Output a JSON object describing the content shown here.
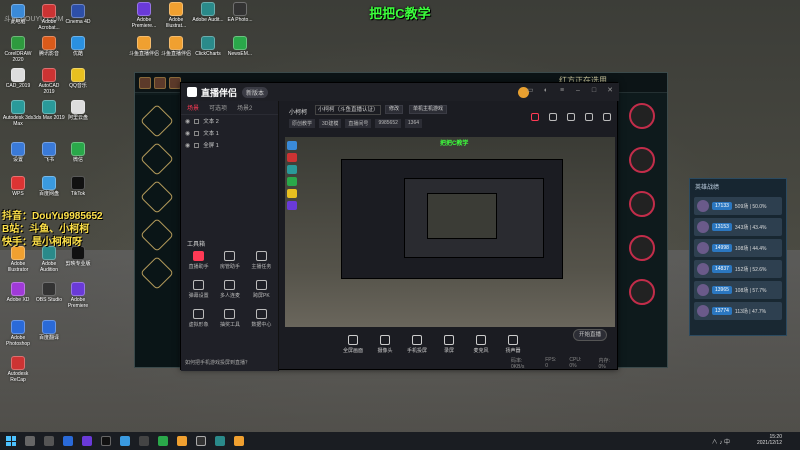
{
  "overlay": {
    "title": "把把C教学",
    "site_logo": "斗鱼 DOUYU.COM",
    "streamer_lines": [
      "抖音：DouYu9985652",
      "B站：斗鱼、小柯柯",
      "快手：是小柯柯呀"
    ]
  },
  "desktop_icons": [
    {
      "label": "此电脑",
      "color": "#3a8ad8"
    },
    {
      "label": "Adobe Acrobat...",
      "color": "#c33"
    },
    {
      "label": "Cinema 4D",
      "color": "#2d4fa8"
    },
    {
      "label": "CorelDRAW 2020",
      "color": "#2e9a3e"
    },
    {
      "label": "腾讯影音",
      "color": "#d95a1a"
    },
    {
      "label": "CAD_2019",
      "color": "#ddd"
    },
    {
      "label": "AutoCAD 2019",
      "color": "#c33"
    },
    {
      "label": "优酷",
      "color": "#2a90e0"
    },
    {
      "label": "Autodesk 3ds Max",
      "color": "#2a9a9a"
    },
    {
      "label": "3ds Max 2019",
      "color": "#2a9a9a"
    },
    {
      "label": "QQ音乐",
      "color": "#e8c020"
    },
    {
      "label": "设置",
      "color": "#3a7ad8"
    },
    {
      "label": "飞书",
      "color": "#3a7ad8"
    },
    {
      "label": "阿里云盘",
      "color": "#ddd"
    },
    {
      "label": "WPS",
      "color": "#d33"
    },
    {
      "label": "百度网盘",
      "color": "#3a9ae0"
    },
    {
      "label": "微信",
      "color": "#2aa84a"
    },
    {
      "label": "Adobe Illustrator",
      "color": "#f0a030"
    },
    {
      "label": "Adobe Audition",
      "color": "#2a8a8a"
    },
    {
      "label": "TikTok",
      "color": "#111"
    },
    {
      "label": "Adobe XD",
      "color": "#a03ad8"
    },
    {
      "label": "剪映专业版",
      "color": "#111"
    },
    {
      "label": "Adobe Photoshop",
      "color": "#2a6ad8"
    },
    {
      "label": "OBS Studio",
      "color": "#333"
    },
    {
      "label": "Adobe Premiere",
      "color": "#6a3ad8"
    },
    {
      "label": "Autodesk ReCap",
      "color": "#c33"
    },
    {
      "label": "百度翻译",
      "color": "#2a6ad8"
    }
  ],
  "top_icons": [
    {
      "label": "Adobe Premiere...",
      "color": "#6a3ad8"
    },
    {
      "label": "Adobe Illustrat...",
      "color": "#f0a030"
    },
    {
      "label": "Adobe Audit...",
      "color": "#2a8a8a"
    },
    {
      "label": "EA Photo...",
      "color": "#333"
    },
    {
      "label": "斗鱼直播伴侣",
      "color": "#f0a030"
    },
    {
      "label": "斗鱼直播伴侣",
      "color": "#f0a030"
    },
    {
      "label": "ClickCharts",
      "color": "#2a8a8a"
    },
    {
      "label": "NewsEM...",
      "color": "#2aa84a"
    }
  ],
  "game_window": {
    "header_text": "红方正在选用",
    "right_rings": 5
  },
  "record_panel": {
    "title": "英雄战绩",
    "rows": [
      {
        "level": "17133",
        "stat": "509场 | 50.0%"
      },
      {
        "level": "13153",
        "stat": "343场 | 43.4%"
      },
      {
        "level": "14998",
        "stat": "108场 | 44.4%"
      },
      {
        "level": "14837",
        "stat": "152场 | 52.6%"
      },
      {
        "level": "13965",
        "stat": "108场 | 57.7%"
      },
      {
        "level": "13774",
        "stat": "113场 | 47.7%"
      }
    ]
  },
  "main_window": {
    "app_name": "直播伴侣",
    "badge": "新版本",
    "left_tabs": [
      "场景",
      "可选项",
      "场景2"
    ],
    "scenes": [
      "文本 2",
      "文本 1",
      "全屏 1"
    ],
    "tools_label": "工具箱",
    "tools": [
      {
        "label": "直播助手",
        "highlight": true
      },
      {
        "label": "房管助手",
        "highlight": false
      },
      {
        "label": "主播任务",
        "highlight": false
      },
      {
        "label": "弹幕设置",
        "highlight": false
      },
      {
        "label": "多人连麦",
        "highlight": false
      },
      {
        "label": "跨屏PK",
        "highlight": false
      },
      {
        "label": "虚拟形象",
        "highlight": false
      },
      {
        "label": "抽奖工具",
        "highlight": false
      },
      {
        "label": "数据中心",
        "highlight": false
      }
    ],
    "bottom_tip": "如何把手机游戏投屏到直播？",
    "room_label": "小柯柯",
    "room_input": "小柯柯（斗鱼直播认证）",
    "edit_btn": "修改",
    "category_btn": "单机主机游戏",
    "tags": [
      "原创教学",
      "3D建模",
      "直播间号",
      "9985652",
      "1364"
    ],
    "preview_label": "把把C教学",
    "bottom_tools": [
      "全屏画面",
      "摄像头",
      "手机投屏",
      "录屏",
      "麦克风",
      "扬声器"
    ],
    "start_btn": "开始直播",
    "status": [
      "码率: 0KB/s",
      "FPS: 0",
      "CPU: 0%",
      "内存: 0%"
    ]
  },
  "taskbar": {
    "time": "15:20",
    "date": "2021/12/12",
    "tray": "∧ ♪ 中"
  }
}
